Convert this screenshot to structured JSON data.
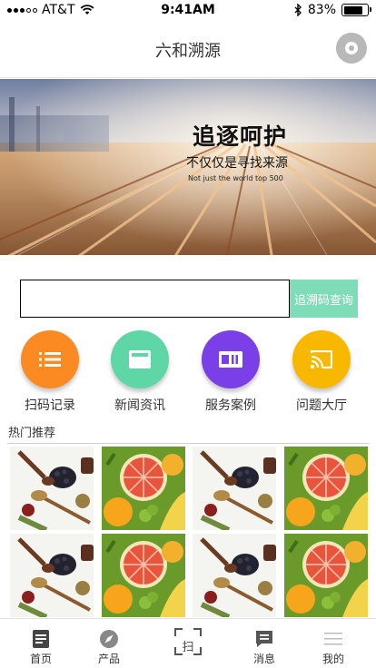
{
  "status_bar": {
    "carrier": "AT&T",
    "time": "9:41AM",
    "battery": "83%",
    "battery_level": 0.83
  },
  "nav": {
    "title": "六和溯源",
    "action_icon": "record-circle-icon"
  },
  "banner": {
    "headline": "追逐呵护",
    "subline": "不仅仅是寻找来源",
    "english": "Not just the world top 500"
  },
  "search": {
    "value": "",
    "placeholder": "",
    "button_label": "追溯码查询",
    "button_color": "#7edcb6"
  },
  "features": [
    {
      "label": "扫码记录",
      "icon": "list-icon",
      "color": "#fc8a22"
    },
    {
      "label": "新闻资讯",
      "icon": "news-icon",
      "color": "#5fd6a6"
    },
    {
      "label": "服务案例",
      "icon": "id-card-icon",
      "color": "#7a3fe6"
    },
    {
      "label": "问题大厅",
      "icon": "cast-icon",
      "color": "#f8b800"
    }
  ],
  "recommend": {
    "title": "热门推荐",
    "products": [
      {
        "image": "spices-image"
      },
      {
        "image": "fruits-image"
      },
      {
        "image": "spices-image"
      },
      {
        "image": "fruits-image"
      },
      {
        "image": "spices-image"
      },
      {
        "image": "fruits-image"
      },
      {
        "image": "spices-image"
      },
      {
        "image": "fruits-image"
      }
    ]
  },
  "tabs": [
    {
      "label": "首页",
      "icon": "home-doc-icon"
    },
    {
      "label": "产品",
      "icon": "compass-icon"
    },
    {
      "label": "扫",
      "icon": "scan-frame-icon"
    },
    {
      "label": "消息",
      "icon": "message-icon"
    },
    {
      "label": "我的",
      "icon": "menu-lines-icon"
    }
  ]
}
